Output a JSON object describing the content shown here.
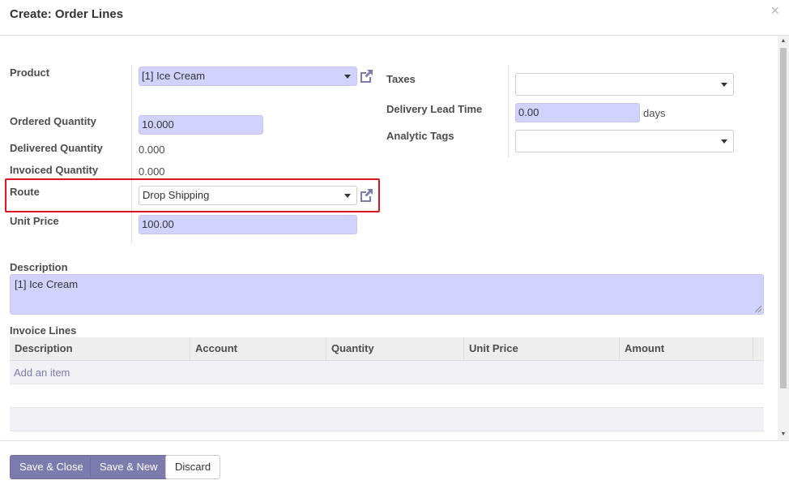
{
  "dialog": {
    "title": "Create: Order Lines",
    "close": "×"
  },
  "form": {
    "product": {
      "label": "Product",
      "value": "[1] Ice Cream"
    },
    "ordered_quantity": {
      "label": "Ordered Quantity",
      "value": "10.000"
    },
    "delivered_quantity": {
      "label": "Delivered Quantity",
      "value": "0.000"
    },
    "invoiced_quantity": {
      "label": "Invoiced Quantity",
      "value": "0.000"
    },
    "route": {
      "label": "Route",
      "value": "Drop Shipping"
    },
    "unit_price": {
      "label": "Unit Price",
      "value": "100.00"
    },
    "taxes": {
      "label": "Taxes",
      "value": ""
    },
    "delivery_lead_time": {
      "label": "Delivery Lead Time",
      "value": "0.00",
      "unit": "days"
    },
    "analytic_tags": {
      "label": "Analytic Tags",
      "value": ""
    },
    "description": {
      "label": "Description",
      "value": "[1] Ice Cream"
    }
  },
  "invoice_lines": {
    "label": "Invoice Lines",
    "columns": [
      "Description",
      "Account",
      "Quantity",
      "Unit Price",
      "Amount"
    ],
    "add_item": "Add an item"
  },
  "footer": {
    "save_close": "Save & Close",
    "save_new": "Save & New",
    "discard": "Discard"
  },
  "colors": {
    "primary": "#7c7bad",
    "required_field": "#d2d2ff",
    "highlight": "#e0141e"
  },
  "icons": {
    "external_link": "external-link-icon",
    "dropdown": "caret-down-icon",
    "close": "close-icon"
  }
}
